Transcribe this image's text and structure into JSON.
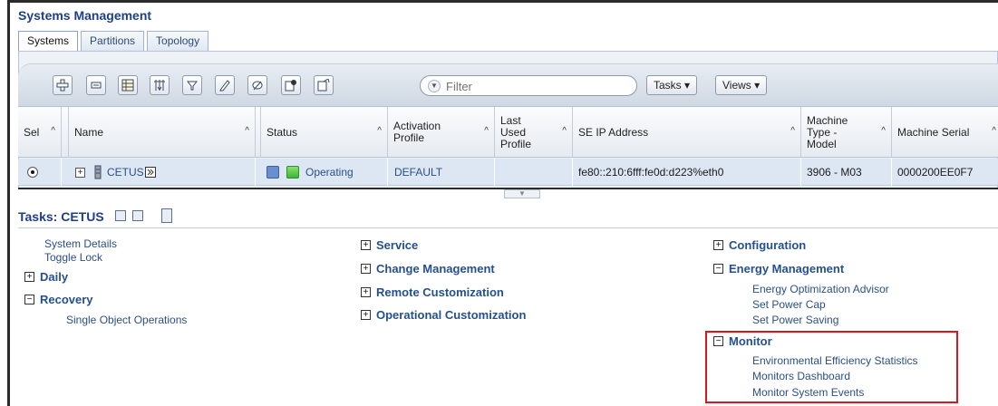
{
  "app_title": "Systems Management",
  "tabs": [
    {
      "label": "Systems",
      "active": true
    },
    {
      "label": "Partitions",
      "active": false
    },
    {
      "label": "Topology",
      "active": false
    }
  ],
  "toolbar": {
    "icons": [
      "add-icon",
      "collapse-icon",
      "table-icon",
      "configure-columns-icon",
      "filter-icon",
      "edit-icon",
      "edit-alt-icon",
      "properties-icon",
      "document-icon"
    ],
    "filter_placeholder": "Filter",
    "tasks_label": "Tasks ▾",
    "views_label": "Views ▾"
  },
  "table": {
    "columns": [
      "Sel",
      "Name",
      "Status",
      "Activation Profile",
      "Last Used Profile",
      "SE IP Address",
      "Machine Type - Model",
      "Machine Serial"
    ],
    "rows": [
      {
        "name": "CETUS",
        "status": "Operating",
        "activation_profile": "DEFAULT",
        "last_used_profile": "",
        "se_ip_address": "fe80::210:6fff:fe0d:d223%eth0",
        "machine_type_model": "3906 - M03",
        "machine_serial": "0000200EE0F7"
      }
    ]
  },
  "tasks_panel": {
    "title": "Tasks: CETUS",
    "col1": {
      "items": [
        "System Details",
        "Toggle Lock"
      ],
      "groups": [
        {
          "label": "Daily",
          "expanded": false,
          "items": []
        },
        {
          "label": "Recovery",
          "expanded": true,
          "items": [
            "Single Object Operations"
          ]
        }
      ]
    },
    "col2": {
      "groups": [
        {
          "label": "Service",
          "expanded": false
        },
        {
          "label": "Change Management",
          "expanded": false
        },
        {
          "label": "Remote Customization",
          "expanded": false
        },
        {
          "label": "Operational Customization",
          "expanded": false
        }
      ]
    },
    "col3": {
      "groups": [
        {
          "label": "Configuration",
          "expanded": false,
          "items": []
        },
        {
          "label": "Energy Management",
          "expanded": true,
          "items": [
            "Energy Optimization Advisor",
            "Set Power Cap",
            "Set Power Saving"
          ]
        },
        {
          "label": "Monitor",
          "expanded": true,
          "items": [
            "Environmental Efficiency Statistics",
            "Monitors Dashboard",
            "Monitor System Events"
          ]
        }
      ]
    }
  },
  "colors": {
    "highlight": "#e0141e",
    "title": "#1d3f8a",
    "link": "#2b4f86"
  }
}
